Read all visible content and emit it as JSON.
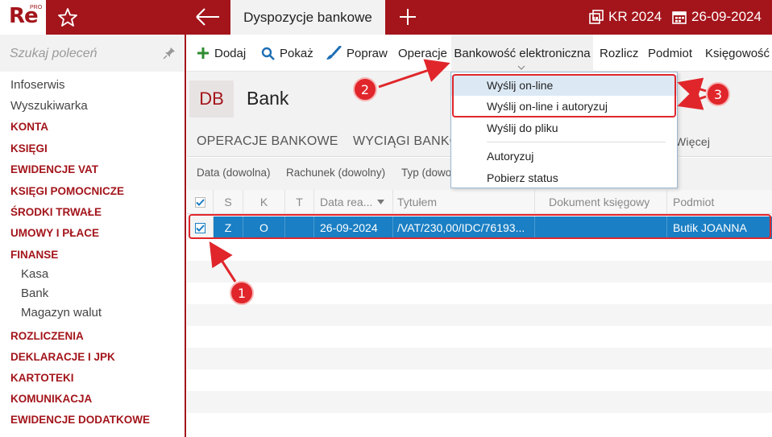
{
  "app": {
    "logo_text": "Re",
    "logo_badge": "PRO",
    "active_tab": "Dyspozycje bankowe",
    "year": "KR 2024",
    "date": "26-09-2024",
    "accent_color": "#a3151b"
  },
  "sidebar": {
    "search_placeholder": "Szukaj poleceń",
    "items": [
      {
        "label": "Infoserwis",
        "kind": "plain"
      },
      {
        "label": "Wyszukiwarka",
        "kind": "plain"
      },
      {
        "label": "KONTA",
        "kind": "section"
      },
      {
        "label": "KSIĘGI",
        "kind": "section"
      },
      {
        "label": "EWIDENCJE VAT",
        "kind": "section"
      },
      {
        "label": "KSIĘGI POMOCNICZE",
        "kind": "section"
      },
      {
        "label": "ŚRODKI TRWAŁE",
        "kind": "section"
      },
      {
        "label": "UMOWY I PŁACE",
        "kind": "section"
      },
      {
        "label": "FINANSE",
        "kind": "section"
      },
      {
        "label": "Kasa",
        "kind": "sub"
      },
      {
        "label": "Bank",
        "kind": "sub"
      },
      {
        "label": "Magazyn walut",
        "kind": "sub"
      },
      {
        "label": "ROZLICZENIA",
        "kind": "section"
      },
      {
        "label": "DEKLARACJE I JPK",
        "kind": "section"
      },
      {
        "label": "KARTOTEKI",
        "kind": "section"
      },
      {
        "label": "KOMUNIKACJA",
        "kind": "section"
      },
      {
        "label": "EWIDENCJE DODATKOWE",
        "kind": "section"
      }
    ]
  },
  "toolbar": {
    "add": "Dodaj",
    "show": "Pokaż",
    "edit": "Popraw",
    "operations": "Operacje",
    "e_banking": "Bankowość elektroniczna",
    "settle": "Rozlicz",
    "entity": "Podmiot",
    "accounting": "Księgowość"
  },
  "header": {
    "badge": "DB",
    "title": "Bank"
  },
  "subtabs": {
    "operations": "OPERACJE BANKOWE",
    "statements": "WYCIĄGI BANKO",
    "more": "Więcej"
  },
  "filters": {
    "date": "Data (dowolna)",
    "account": "Rachunek (dowolny)",
    "type": "Typ (dowo"
  },
  "table": {
    "columns": {
      "s": "S",
      "k": "K",
      "t": "T",
      "date": "Data rea...",
      "title": "Tytułem",
      "doc": "Dokument księgowy",
      "entity": "Podmiot"
    },
    "rows": [
      {
        "s": "Z",
        "k": "O",
        "t": "",
        "date": "26-09-2024",
        "title": "/VAT/230,00/IDC/76193...",
        "doc": "",
        "entity": "Butik JOANNA",
        "checked": true
      }
    ]
  },
  "dropdown": {
    "items": [
      "Wyślij on-line",
      "Wyślij on-line i autoryzuj",
      "Wyślij do pliku",
      "Autoryzuj",
      "Pobierz status"
    ]
  },
  "annotations": {
    "badge1": "1",
    "badge2": "2",
    "badge3": "3"
  }
}
